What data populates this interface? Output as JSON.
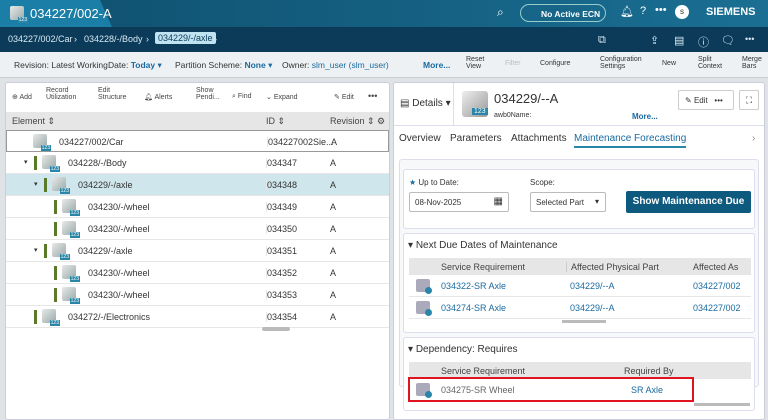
{
  "header": {
    "title": "034227/002-A",
    "ecn": "No Active ECN",
    "avatar": "s",
    "brand": "SIEMENS"
  },
  "breadcrumb": [
    "034227/002/Car",
    "034228/-/Body",
    "034229/-/axle"
  ],
  "context": {
    "revision_label": "Revision:",
    "revision": "Latest Working",
    "date_label": "Date:",
    "date": "Today",
    "partition_label": "Partition Scheme:",
    "partition": "None",
    "owner_label": "Owner:",
    "owner": "slm_user (slm_user)",
    "more": "More..."
  },
  "actions": {
    "reset": "Reset View",
    "filter": "Filter",
    "configure": "Configure",
    "config_settings": "Configuration Settings",
    "new": "New",
    "split": "Split Context",
    "merge": "Merge Bars"
  },
  "left_toolbar": {
    "add": "Add",
    "record": "Record Utilization",
    "edit_structure": "Edit Structure",
    "alerts": "Alerts",
    "show_pending": "Show Pendi...",
    "find": "Find",
    "expand": "Expand",
    "edit": "Edit"
  },
  "tree": {
    "columns": [
      "Element",
      "ID",
      "Revision"
    ],
    "rows": [
      {
        "element": "034227/002/Car",
        "id": "034227002Sie...",
        "rev": "A"
      },
      {
        "element": "034228/-/Body",
        "id": "034347",
        "rev": "A"
      },
      {
        "element": "034229/-/axle",
        "id": "034348",
        "rev": "A"
      },
      {
        "element": "034230/-/wheel",
        "id": "034349",
        "rev": "A"
      },
      {
        "element": "034230/-/wheel",
        "id": "034350",
        "rev": "A"
      },
      {
        "element": "034229/-/axle",
        "id": "034351",
        "rev": "A"
      },
      {
        "element": "034230/-/wheel",
        "id": "034352",
        "rev": "A"
      },
      {
        "element": "034230/-/wheel",
        "id": "034353",
        "rev": "A"
      },
      {
        "element": "034272/-/Electronics",
        "id": "034354",
        "rev": "A"
      }
    ]
  },
  "details": {
    "label": "Details",
    "title": "034229/--A",
    "name_label": "awb0Name:",
    "more": "More...",
    "edit": "Edit",
    "tabs": [
      "Overview",
      "Parameters",
      "Attachments",
      "Maintenance Forecasting"
    ]
  },
  "form": {
    "date_label": "Up to Date:",
    "date": "08-Nov-2025",
    "scope_label": "Scope:",
    "scope": "Selected Part",
    "button": "Show Maintenance Due"
  },
  "next_due": {
    "title": "Next Due Dates of Maintenance",
    "columns": [
      "Service Requirement",
      "Affected Physical Part",
      "Affected As"
    ],
    "rows": [
      {
        "sr": "034322-SR Axle",
        "part": "034229/--A",
        "as": "034227/002"
      },
      {
        "sr": "034274-SR Axle",
        "part": "034229/--A",
        "as": "034227/002"
      }
    ]
  },
  "dependency": {
    "title": "Dependency: Requires",
    "columns": [
      "Service Requirement",
      "Required By"
    ],
    "rows": [
      {
        "sr": "034275-SR Wheel",
        "by": "SR Axle"
      }
    ]
  }
}
